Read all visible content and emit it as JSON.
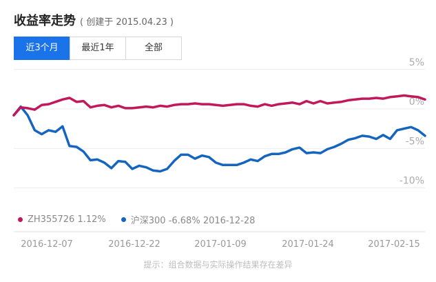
{
  "header": {
    "title": "收益率走势",
    "subtitle": "( 创建于 2015.04.23 )"
  },
  "tabs": [
    {
      "label": "近3个月",
      "active": true
    },
    {
      "label": "最近1年",
      "active": false
    },
    {
      "label": "全部",
      "active": false
    }
  ],
  "legend": [
    {
      "label": "ZH355726 1.12%",
      "color": "#c2185b"
    },
    {
      "label": "沪深300 -6.68% 2016-12-28",
      "color": "#1565c0"
    }
  ],
  "hint": "提示：组合数据与实际操作结果存在差异",
  "chart_data": {
    "type": "line",
    "x_ticks": [
      "2016-12-07",
      "2016-12-22",
      "2017-01-09",
      "2017-01-24",
      "2017-02-15"
    ],
    "y_ticks": [
      "5%",
      "0%",
      "-5%",
      "-10%"
    ],
    "ylim": [
      -11.5,
      5
    ],
    "grid": true,
    "series": [
      {
        "name": "ZH355726",
        "color": "#c2185b",
        "values": [
          -0.8,
          0.2,
          0.1,
          -0.1,
          0.5,
          0.6,
          0.9,
          1.2,
          1.4,
          0.9,
          1.0,
          0.2,
          0.4,
          0.5,
          0.2,
          0.4,
          0.1,
          0.1,
          0.2,
          0.3,
          0.2,
          0.4,
          0.3,
          0.5,
          0.6,
          0.6,
          0.7,
          0.6,
          0.6,
          0.5,
          0.4,
          0.5,
          0.6,
          0.6,
          0.4,
          0.3,
          0.6,
          0.4,
          0.6,
          0.7,
          0.8,
          0.6,
          1.0,
          0.7,
          1.0,
          0.7,
          0.8,
          0.9,
          1.1,
          1.2,
          1.3,
          1.3,
          1.4,
          1.3,
          1.5,
          1.6,
          1.7,
          1.6,
          1.5,
          1.2
        ]
      },
      {
        "name": "沪深300",
        "color": "#1565c0",
        "values": [
          -0.8,
          0.3,
          -0.8,
          -2.7,
          -3.2,
          -2.7,
          -2.9,
          -2.2,
          -4.7,
          -4.8,
          -5.4,
          -6.5,
          -6.4,
          -6.8,
          -7.5,
          -6.6,
          -6.7,
          -7.6,
          -7.2,
          -7.4,
          -7.8,
          -7.9,
          -7.6,
          -6.6,
          -5.8,
          -5.8,
          -6.3,
          -5.9,
          -6.1,
          -6.8,
          -7.1,
          -7.1,
          -7.1,
          -6.8,
          -6.4,
          -6.6,
          -6.0,
          -5.7,
          -5.7,
          -5.5,
          -5.1,
          -4.9,
          -5.6,
          -5.5,
          -5.6,
          -5.1,
          -4.8,
          -4.4,
          -3.9,
          -3.7,
          -3.4,
          -3.5,
          -3.8,
          -3.3,
          -3.8,
          -2.7,
          -2.5,
          -2.3,
          -2.7,
          -3.4
        ]
      }
    ]
  }
}
